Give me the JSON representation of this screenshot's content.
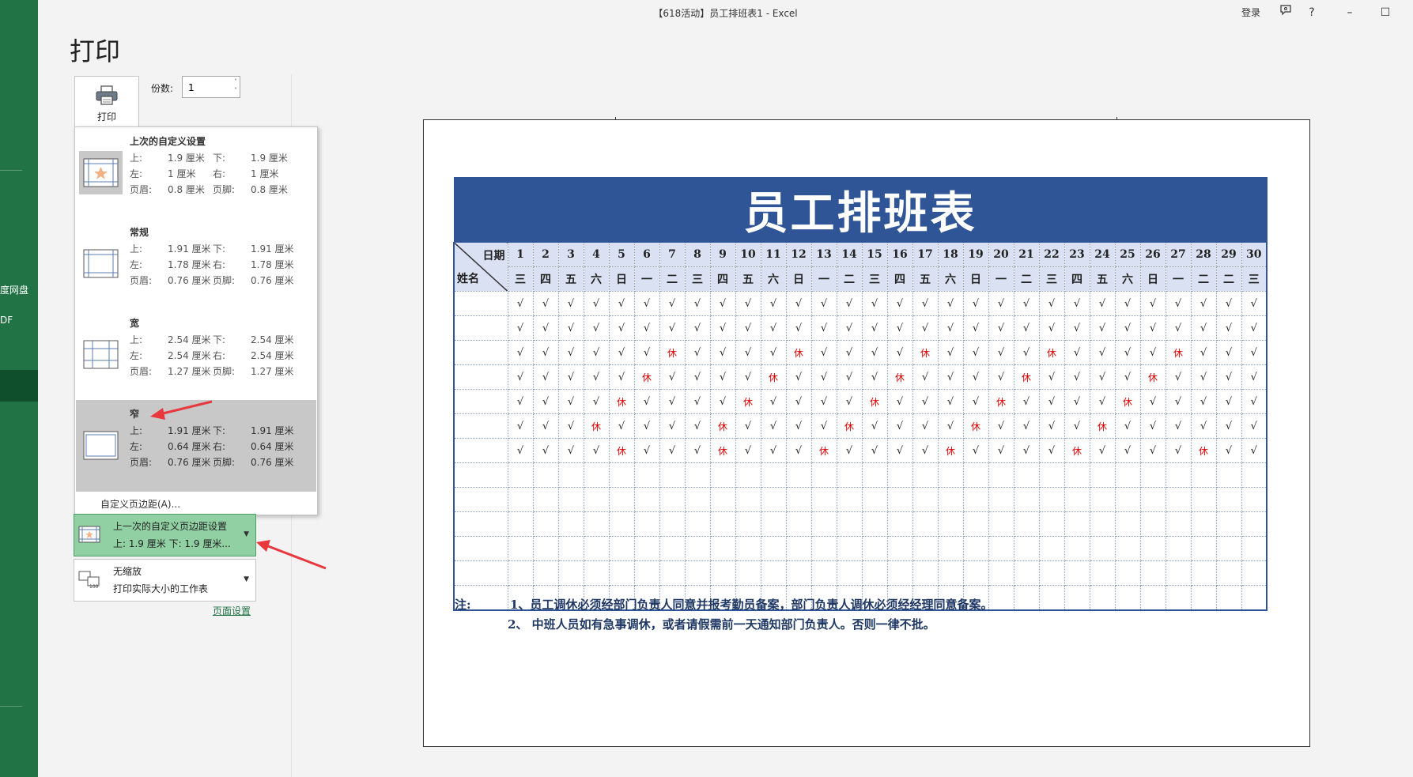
{
  "window": {
    "title": "【618活动】员工排班表1  -  Excel",
    "signin": "登录",
    "help": "?",
    "minimize": "–",
    "maximize": "☐"
  },
  "backstage": {
    "rail_items": [
      "度网盘",
      "DF"
    ],
    "heading": "打印"
  },
  "print": {
    "button_label": "打印",
    "copies_label": "份数:",
    "copies_value": "1"
  },
  "margins_menu": {
    "options": [
      {
        "name": "上次的自定义设置",
        "top_label": "上:",
        "top": "1.9 厘米",
        "bottom_label": "下:",
        "bottom": "1.9 厘米",
        "left_label": "左:",
        "left": "1 厘米",
        "right_label": "右:",
        "right": "1 厘米",
        "header_label": "页眉:",
        "header": "0.8 厘米",
        "footer_label": "页脚:",
        "footer": "0.8 厘米"
      },
      {
        "name": "常规",
        "top_label": "上:",
        "top": "1.91 厘米",
        "bottom_label": "下:",
        "bottom": "1.91 厘米",
        "left_label": "左:",
        "left": "1.78 厘米",
        "right_label": "右:",
        "right": "1.78 厘米",
        "header_label": "页眉:",
        "header": "0.76 厘米",
        "footer_label": "页脚:",
        "footer": "0.76 厘米"
      },
      {
        "name": "宽",
        "top_label": "上:",
        "top": "2.54 厘米",
        "bottom_label": "下:",
        "bottom": "2.54 厘米",
        "left_label": "左:",
        "left": "2.54 厘米",
        "right_label": "右:",
        "right": "2.54 厘米",
        "header_label": "页眉:",
        "header": "1.27 厘米",
        "footer_label": "页脚:",
        "footer": "1.27 厘米"
      },
      {
        "name": "窄",
        "top_label": "上:",
        "top": "1.91 厘米",
        "bottom_label": "下:",
        "bottom": "1.91 厘米",
        "left_label": "左:",
        "left": "0.64 厘米",
        "right_label": "右:",
        "right": "0.64 厘米",
        "header_label": "页眉:",
        "header": "0.76 厘米",
        "footer_label": "页脚:",
        "footer": "0.76 厘米"
      }
    ],
    "selected_index": 3,
    "custom_label": "自定义页边距(A)..."
  },
  "margin_selector": {
    "line1": "上一次的自定义页边距设置",
    "line2": "上: 1.9 厘米 下: 1.9 厘米..."
  },
  "scaling_selector": {
    "line1": "无缩放",
    "line2": "打印实际大小的工作表"
  },
  "page_setup_link": "页面设置",
  "colors": {
    "excel_green": "#217346",
    "sheet_title_blue": "#2f5597",
    "header_fill": "#d9e1f2",
    "rest_red": "#e00000",
    "arrow_red": "#e8383d"
  },
  "schedule": {
    "title": "员工排班表",
    "date_label": "日期",
    "name_label": "姓名",
    "days": [
      "1",
      "2",
      "3",
      "4",
      "5",
      "6",
      "7",
      "8",
      "9",
      "10",
      "11",
      "12",
      "13",
      "14",
      "15",
      "16",
      "17",
      "18",
      "19",
      "20",
      "21",
      "22",
      "23",
      "24",
      "25",
      "26",
      "27",
      "28",
      "29",
      "30"
    ],
    "weekdays": [
      "三",
      "四",
      "五",
      "六",
      "日",
      "一",
      "二",
      "三",
      "四",
      "五",
      "六",
      "日",
      "一",
      "二",
      "三",
      "四",
      "五",
      "六",
      "日",
      "一",
      "二",
      "三",
      "四",
      "五",
      "六",
      "日",
      "一",
      "二",
      "二",
      "三"
    ],
    "work_mark": "√",
    "rest_mark": "休",
    "rows": [
      "WWWWWWWWWWWWWWWWWWWWWWWWWWWWWW",
      "WWWWWWWWWWWWWWWWWWWWWWWWWWWWWW",
      "WWWWWWRWWWWRWWWWRWWWWRWWWWRWWW",
      "WWWWWRWWWWRWWWWRWWWWRWWWWRWWWW",
      "WWWWRWWWWRWWWWRWWWWRWWWWRWWWWW",
      "WWWRWWWWRWWWWRWWWWRWWWWRWWWWWW",
      "WWWWRWWWRWWWRWWWWRWWWWRWWWWRWW",
      "",
      "",
      "",
      "",
      "",
      ""
    ],
    "notes": [
      "注:",
      "1、员工调休必须经部门负责人同意并报考勤员备案，部门负责人调休必须经经理同意备案。",
      "2、 中班人员如有急事调休，或者请假需前一天通知部门负责人。否则一律不批。"
    ]
  }
}
